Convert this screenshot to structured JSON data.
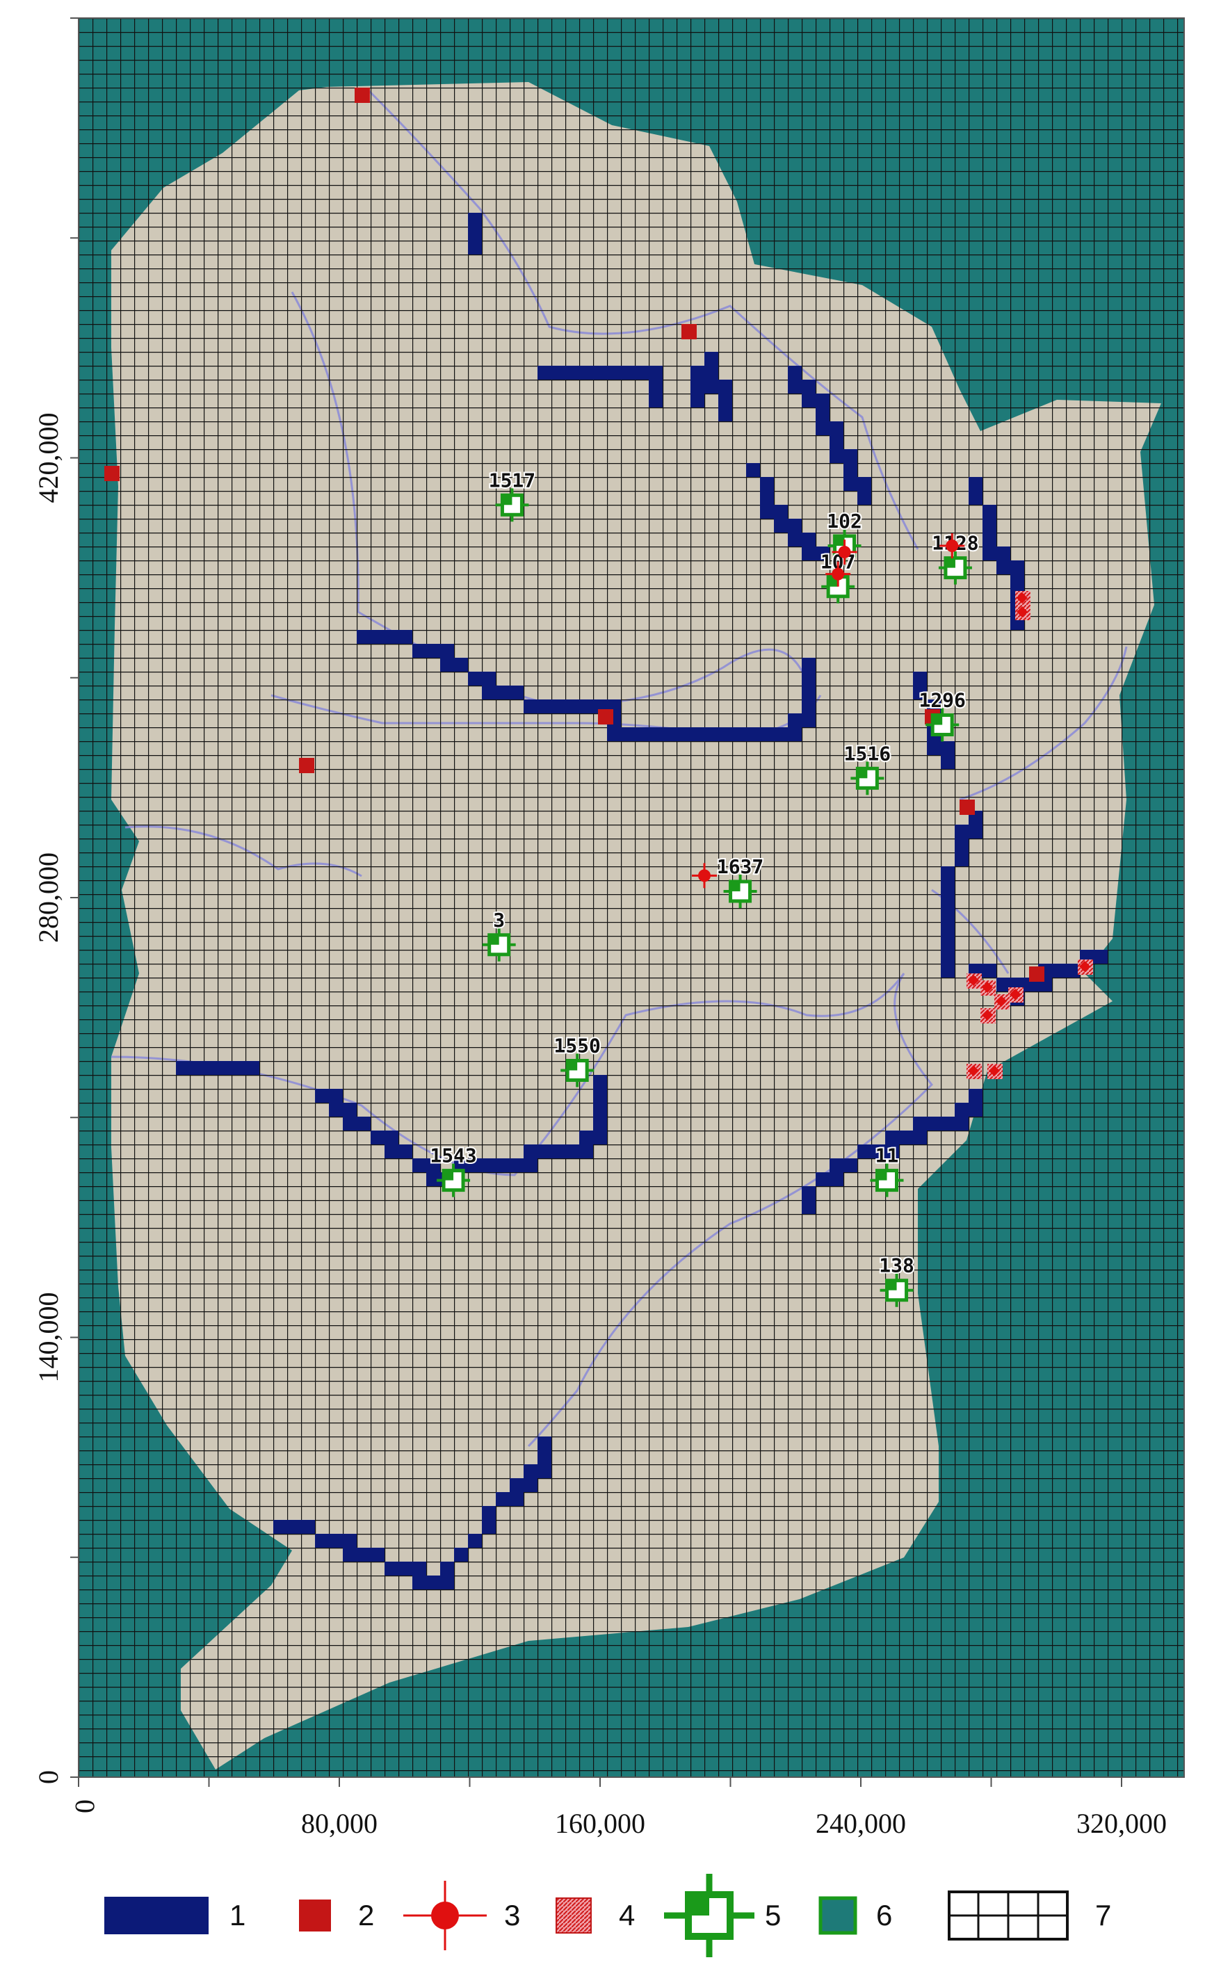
{
  "axes": {
    "x_ticks": [
      "0",
      "80,000",
      "160,000",
      "240,000",
      "320,000"
    ],
    "y_ticks": [
      "0",
      "140,000",
      "280,000",
      "420,000"
    ],
    "x_range": [
      0,
      320000
    ],
    "y_range": [
      0,
      560000
    ]
  },
  "colors": {
    "background_cells": "#1e7a78",
    "active_domain": "#cfc8b8",
    "river_cells": "#0c1a78",
    "drain_cells": "#c41616",
    "well": "#e01010",
    "spring_cells": "#e8506a",
    "observation_wells": "#1a9a1a",
    "grid_lines": "#111111",
    "rivers_lines": "#8a8ad8"
  },
  "observation_wells": [
    {
      "label": "1517",
      "x": 133000,
      "y": 405000
    },
    {
      "label": "102",
      "x": 235000,
      "y": 392000
    },
    {
      "label": "107",
      "x": 233000,
      "y": 379000
    },
    {
      "label": "1128",
      "x": 269000,
      "y": 385000
    },
    {
      "label": "1296",
      "x": 265000,
      "y": 335000
    },
    {
      "label": "1516",
      "x": 242000,
      "y": 318000
    },
    {
      "label": "1637",
      "x": 203000,
      "y": 282000
    },
    {
      "label": "3",
      "x": 129000,
      "y": 265000
    },
    {
      "label": "1550",
      "x": 153000,
      "y": 225000
    },
    {
      "label": "1543",
      "x": 115000,
      "y": 190000
    },
    {
      "label": "11",
      "x": 248000,
      "y": 190000
    },
    {
      "label": "138",
      "x": 251000,
      "y": 155000
    }
  ],
  "pumping_wells": [
    {
      "x": 192000,
      "y": 287000
    },
    {
      "x": 235000,
      "y": 390000
    },
    {
      "x": 233000,
      "y": 383000
    },
    {
      "x": 268000,
      "y": 392000
    }
  ],
  "legend": [
    {
      "key": "1",
      "label": "1",
      "symbol": "river-cells"
    },
    {
      "key": "2",
      "label": "2",
      "symbol": "drain-cells"
    },
    {
      "key": "3",
      "label": "3",
      "symbol": "pumping-well"
    },
    {
      "key": "4",
      "label": "4",
      "symbol": "spring-cells"
    },
    {
      "key": "5",
      "label": "5",
      "symbol": "observation-well"
    },
    {
      "key": "6",
      "label": "6",
      "symbol": "inactive-cells"
    },
    {
      "key": "7",
      "label": "7",
      "symbol": "model-grid"
    }
  ]
}
